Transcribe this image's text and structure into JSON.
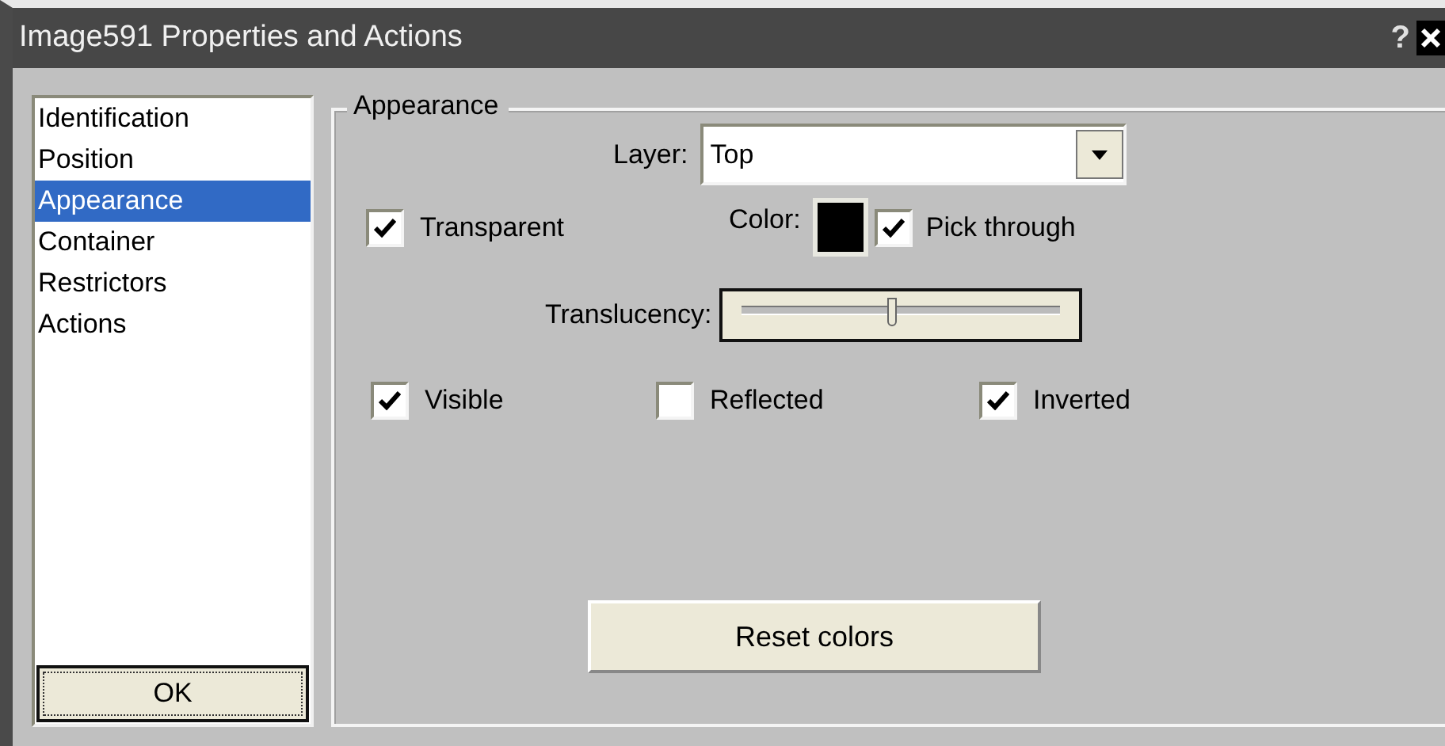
{
  "window": {
    "title": "Image591 Properties and Actions",
    "help": "?"
  },
  "sidebar": {
    "items": [
      {
        "label": "Identification",
        "selected": false
      },
      {
        "label": "Position",
        "selected": false
      },
      {
        "label": "Appearance",
        "selected": true
      },
      {
        "label": "Container",
        "selected": false
      },
      {
        "label": "Restrictors",
        "selected": false
      },
      {
        "label": "Actions",
        "selected": false
      }
    ],
    "ok_button": "OK"
  },
  "appearance": {
    "legend": "Appearance",
    "layer": {
      "label": "Layer:",
      "value": "Top"
    },
    "transparent": {
      "label": "Transparent",
      "checked": true
    },
    "color": {
      "label": "Color:",
      "color": "#000000"
    },
    "pick_through": {
      "label": "Pick through",
      "checked": true
    },
    "translucency": {
      "label": "Translucency:",
      "level": 0.47
    },
    "flags": [
      {
        "label": "Visible",
        "checked": true
      },
      {
        "label": "Reflected",
        "checked": false
      },
      {
        "label": "Inverted",
        "checked": true
      }
    ],
    "reset_button": "Reset colors"
  }
}
